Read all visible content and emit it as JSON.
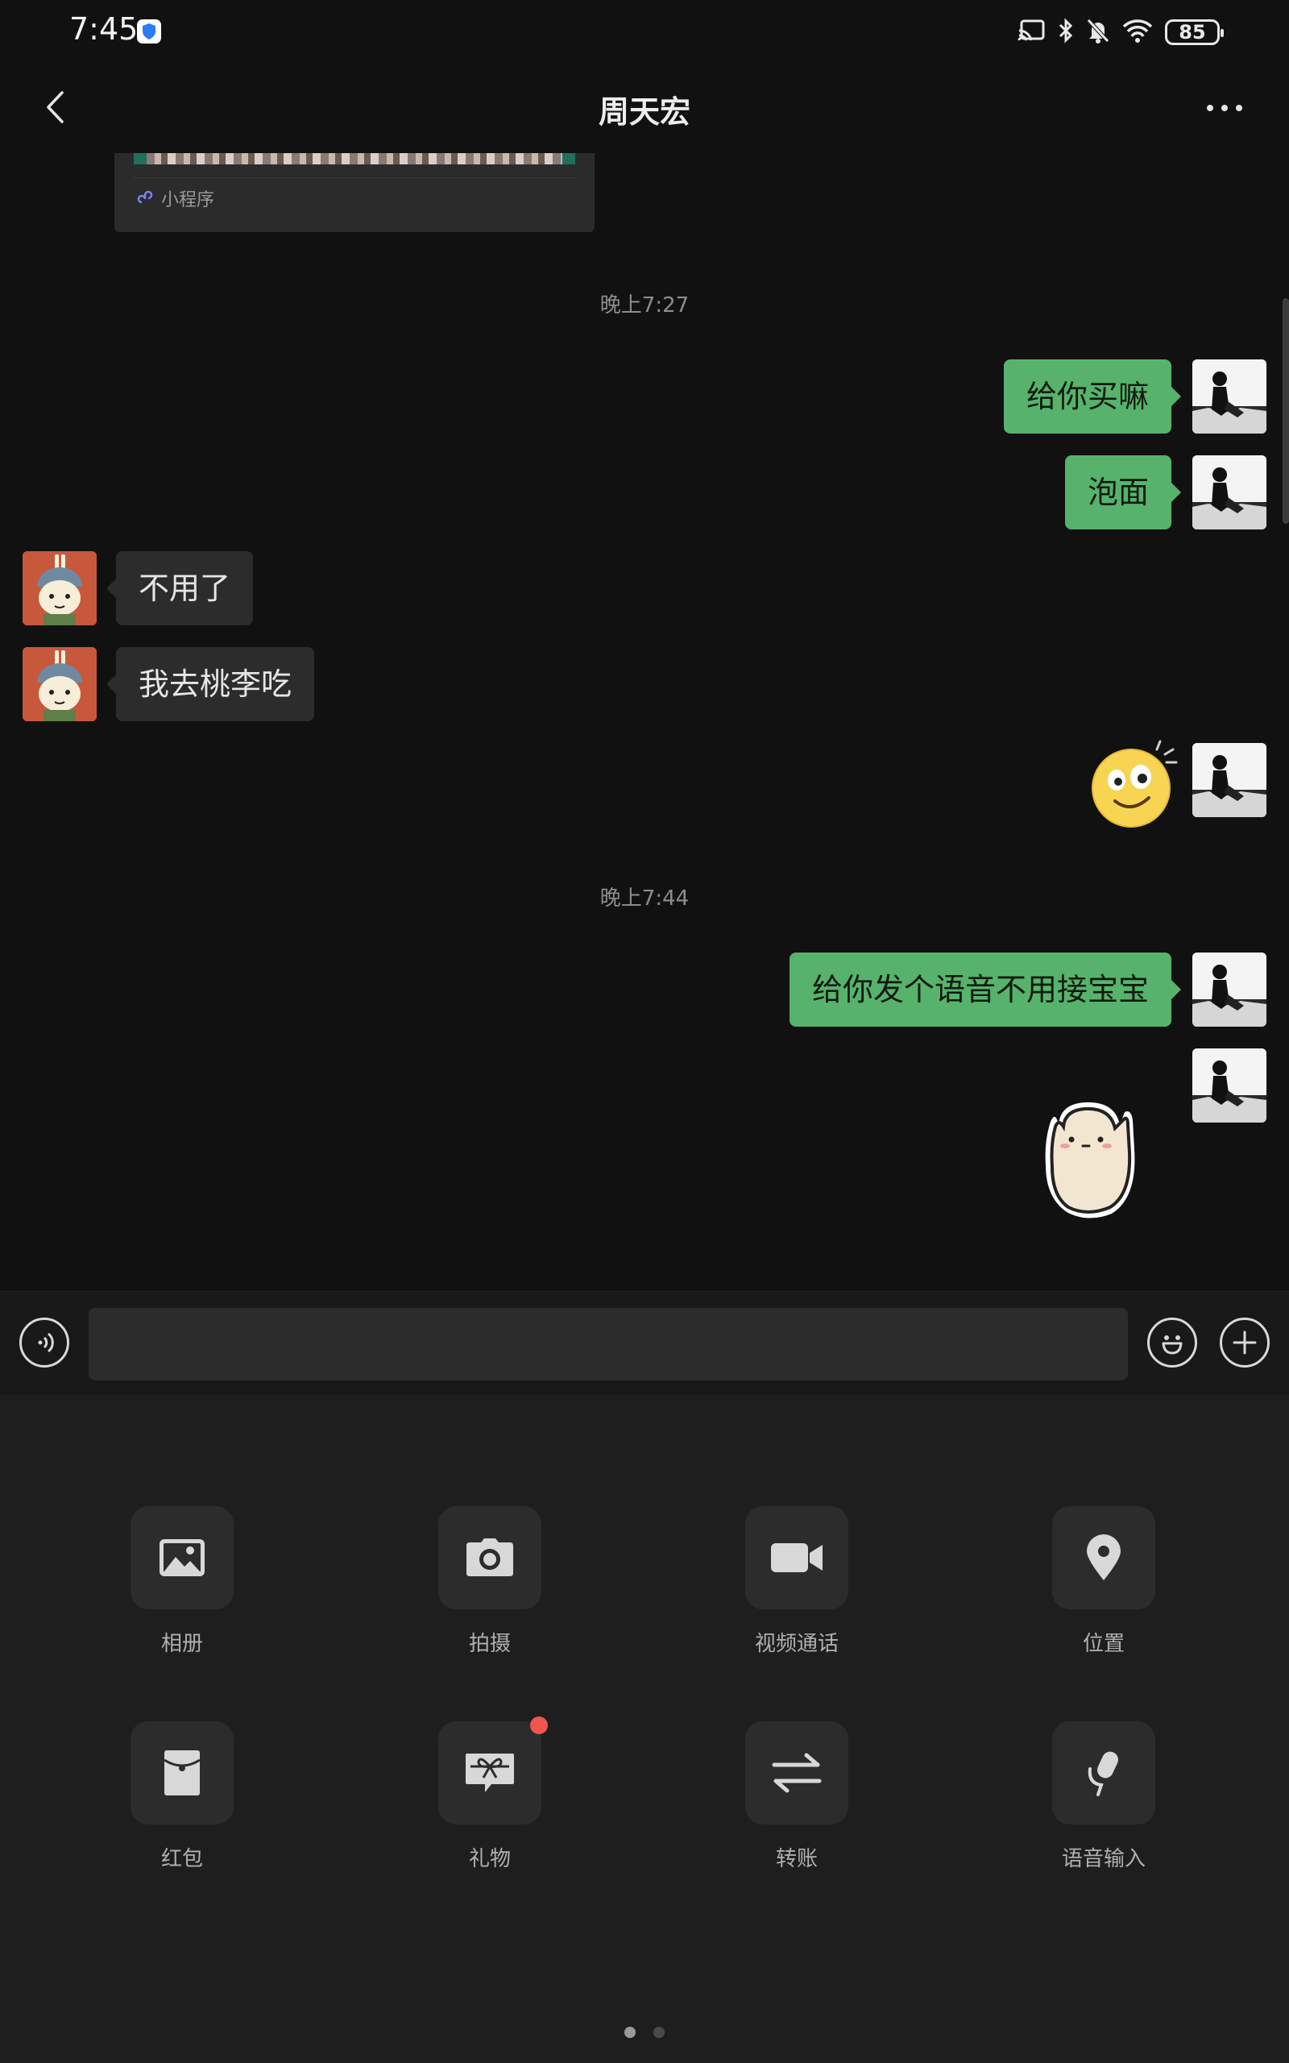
{
  "status_bar": {
    "time": "7:45",
    "battery": "85"
  },
  "header": {
    "title": "周天宏"
  },
  "chat": {
    "mini_program_label": "小程序",
    "timestamps": [
      "晚上7:27",
      "晚上7:44"
    ],
    "messages": [
      {
        "sender": "me",
        "text": "给你买嘛"
      },
      {
        "sender": "me",
        "text": "泡面"
      },
      {
        "sender": "other",
        "text": "不用了"
      },
      {
        "sender": "other",
        "text": "我去桃李吃"
      },
      {
        "sender": "me",
        "type": "emoji",
        "text": ""
      },
      {
        "sender": "me",
        "text": "给你发个语音不用接宝宝"
      },
      {
        "sender": "me",
        "type": "sticker",
        "text": ""
      }
    ]
  },
  "input": {
    "value": "",
    "placeholder": ""
  },
  "panel": {
    "actions": [
      {
        "label": "相册",
        "icon": "photo-album-icon"
      },
      {
        "label": "拍摄",
        "icon": "camera-icon"
      },
      {
        "label": "视频通话",
        "icon": "video-call-icon"
      },
      {
        "label": "位置",
        "icon": "location-pin-icon"
      },
      {
        "label": "红包",
        "icon": "red-packet-icon"
      },
      {
        "label": "礼物",
        "icon": "gift-icon",
        "badge": true
      },
      {
        "label": "转账",
        "icon": "transfer-icon"
      },
      {
        "label": "语音输入",
        "icon": "microphone-icon"
      }
    ],
    "page_count": 2,
    "active_page": 1
  },
  "colors": {
    "background": "#111111",
    "my_bubble": "#57b36b",
    "other_bubble": "#2c2c2c",
    "panel": "#1e1e1e",
    "badge": "#f0564d"
  }
}
